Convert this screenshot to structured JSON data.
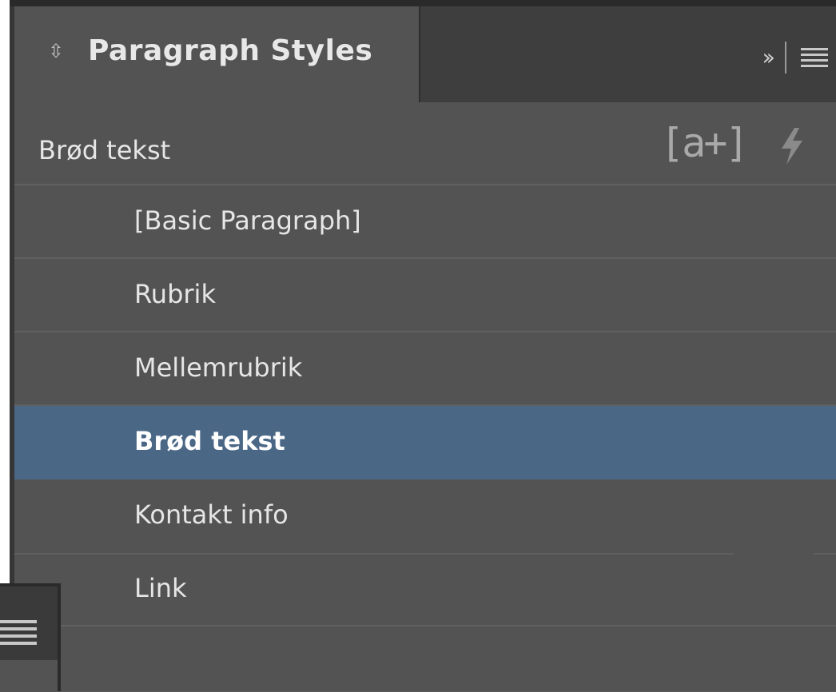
{
  "panel": {
    "tab_label": "Paragraph Styles",
    "tab_arrows_icon": "up-down-arrows-icon",
    "collapse_glyph": "››",
    "menu_icon": "hamburger-menu-icon"
  },
  "current_style": {
    "label": "Brød tekst",
    "new_style_glyph": "[a+]",
    "new_style_icon": "create-new-style-icon",
    "quick_apply_icon": "lightning-icon"
  },
  "styles": [
    {
      "label": "[Basic Paragraph]",
      "selected": false
    },
    {
      "label": "Rubrik",
      "selected": false
    },
    {
      "label": "Mellemrubrik",
      "selected": false
    },
    {
      "label": "Brød tekst",
      "selected": true
    },
    {
      "label": "Kontakt info",
      "selected": false
    },
    {
      "label": "Link",
      "selected": false
    }
  ],
  "colors": {
    "panel_bg": "#535353",
    "tabbar_bg": "#3e3e3e",
    "selection": "#4a6786",
    "text": "#e6e6e6"
  }
}
